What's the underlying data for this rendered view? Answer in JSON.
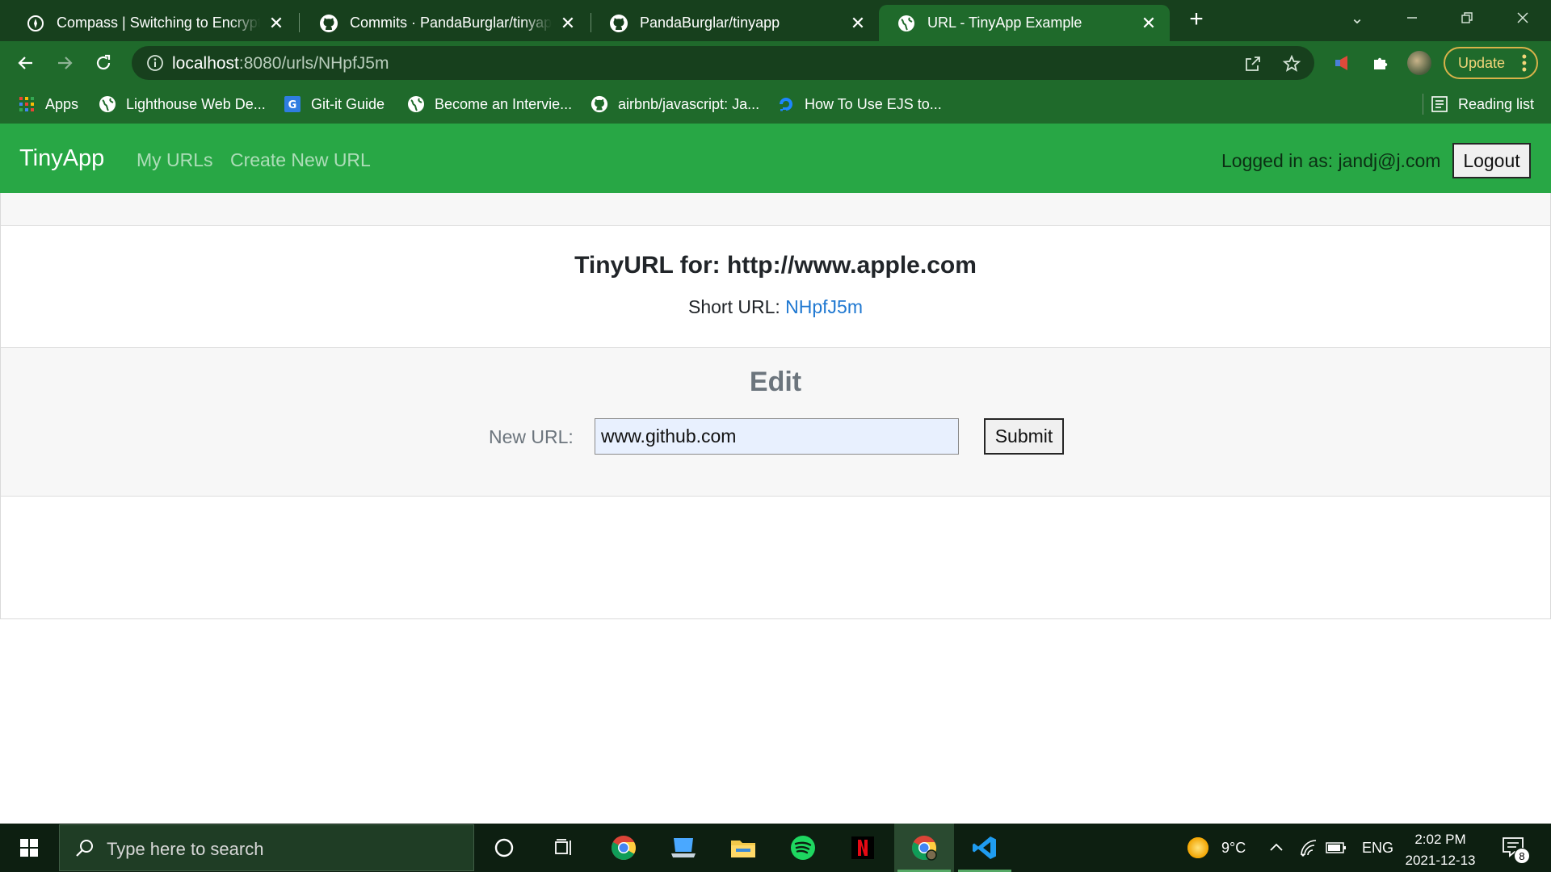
{
  "browser": {
    "tabs": [
      {
        "title": "Compass | Switching to Encrypted",
        "icon": "compass-icon",
        "active": false
      },
      {
        "title": "Commits · PandaBurglar/tinyapp",
        "icon": "github-icon",
        "active": false
      },
      {
        "title": "PandaBurglar/tinyapp",
        "icon": "github-icon",
        "active": false
      },
      {
        "title": "URL - TinyApp Example",
        "icon": "globe-icon",
        "active": true
      }
    ],
    "address": {
      "host": "localhost",
      "path": ":8080/urls/NHpfJ5m"
    },
    "update_label": "Update",
    "bookmarks": [
      {
        "label": "Apps",
        "icon": "apps-grid-icon"
      },
      {
        "label": "Lighthouse Web De...",
        "icon": "globe-icon"
      },
      {
        "label": "Git-it Guide",
        "icon": "g-badge-icon"
      },
      {
        "label": "Become an Intervie...",
        "icon": "globe-icon"
      },
      {
        "label": "airbnb/javascript: Ja...",
        "icon": "github-icon"
      },
      {
        "label": "How To Use EJS to...",
        "icon": "digitalocean-icon"
      }
    ],
    "reading_list_label": "Reading list"
  },
  "app": {
    "brand": "TinyApp",
    "nav": {
      "my_urls": "My URLs",
      "create_new": "Create New URL"
    },
    "logged_in_text": "Logged in as: jandj@j.com",
    "logout_label": "Logout",
    "card": {
      "title": "TinyURL for: http://www.apple.com",
      "short_url_label": "Short URL: ",
      "short_url": "NHpfJ5m",
      "edit_title": "Edit",
      "new_url_label": "New URL:",
      "new_url_value": "www.github.com",
      "submit_label": "Submit"
    }
  },
  "taskbar": {
    "search_placeholder": "Type here to search",
    "weather": "9°C",
    "language": "ENG",
    "time": "2:02 PM",
    "date": "2021-12-13",
    "notification_count": "8"
  },
  "colors": {
    "app_nav": "#28a745",
    "chrome": "#1f6a2b",
    "link": "#1f78d1"
  }
}
